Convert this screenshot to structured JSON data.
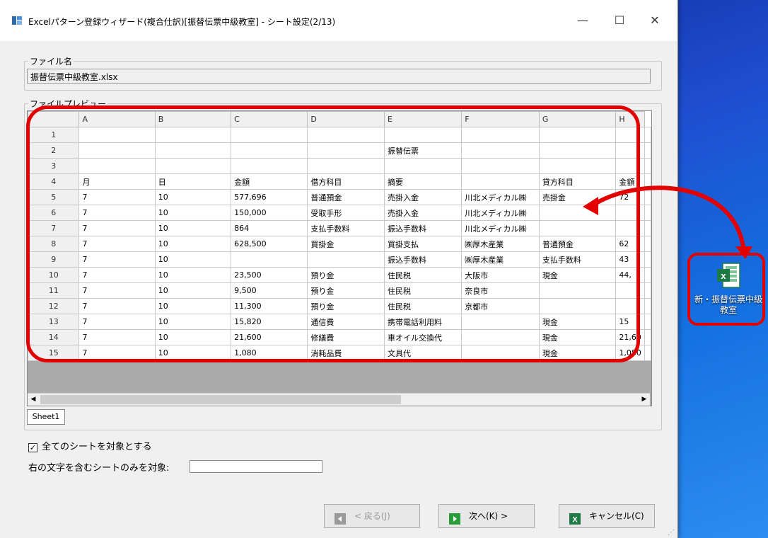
{
  "window": {
    "title": "Excelパターン登録ウィザード(複合仕訳)[振替伝票中級教室] - シート設定(2/13)",
    "minimize": "—",
    "maximize": "☐",
    "close": "✕"
  },
  "file_section": {
    "label": "ファイル名",
    "value": "振替伝票中級教室.xlsx"
  },
  "preview_section": {
    "label": "ファイルプレビュー",
    "columns": [
      "A",
      "B",
      "C",
      "D",
      "E",
      "F",
      "G",
      "H"
    ],
    "rows": [
      {
        "n": "1",
        "cells": [
          "",
          "",
          "",
          "",
          "",
          "",
          "",
          ""
        ]
      },
      {
        "n": "2",
        "cells": [
          "",
          "",
          "",
          "",
          "振替伝票",
          "",
          "",
          ""
        ]
      },
      {
        "n": "3",
        "cells": [
          "",
          "",
          "",
          "",
          "",
          "",
          "",
          ""
        ]
      },
      {
        "n": "4",
        "cells": [
          "月",
          "日",
          "金額",
          "借方科目",
          "摘要",
          "",
          "貸方科目",
          "金額"
        ]
      },
      {
        "n": "5",
        "cells": [
          "7",
          "10",
          "577,696",
          "普通預金",
          "売掛入金",
          "川北メディカル㈱",
          "売掛金",
          "72"
        ]
      },
      {
        "n": "6",
        "cells": [
          "7",
          "10",
          "150,000",
          "受取手形",
          "売掛入金",
          "川北メディカル㈱",
          "",
          ""
        ]
      },
      {
        "n": "7",
        "cells": [
          "7",
          "10",
          "864",
          "支払手数料",
          "振込手数料",
          "川北メディカル㈱",
          "",
          ""
        ]
      },
      {
        "n": "8",
        "cells": [
          "7",
          "10",
          "628,500",
          "買掛金",
          "買掛支払",
          "㈱厚木産業",
          "普通預金",
          "62"
        ]
      },
      {
        "n": "9",
        "cells": [
          "7",
          "10",
          "",
          "",
          "振込手数料",
          "㈱厚木産業",
          "支払手数料",
          "43"
        ]
      },
      {
        "n": "10",
        "cells": [
          "7",
          "10",
          "23,500",
          "預り金",
          "住民税",
          "大阪市",
          "現金",
          "44,"
        ]
      },
      {
        "n": "11",
        "cells": [
          "7",
          "10",
          "9,500",
          "預り金",
          "住民税",
          "奈良市",
          "",
          ""
        ]
      },
      {
        "n": "12",
        "cells": [
          "7",
          "10",
          "11,300",
          "預り金",
          "住民税",
          "京都市",
          "",
          ""
        ]
      },
      {
        "n": "13",
        "cells": [
          "7",
          "10",
          "15,820",
          "通信費",
          "携帯電話利用料",
          "",
          "現金",
          "15"
        ]
      },
      {
        "n": "14",
        "cells": [
          "7",
          "10",
          "21,600",
          "修繕費",
          "車オイル交換代",
          "",
          "現金",
          "21,60"
        ]
      },
      {
        "n": "15",
        "cells": [
          "7",
          "10",
          "1,080",
          "消耗品費",
          "文具代",
          "",
          "現金",
          "1,080"
        ]
      }
    ],
    "sheet_tab": "Sheet1"
  },
  "options": {
    "all_sheets_label": "全てのシートを対象とする",
    "all_sheets_checked": true,
    "filter_label": "右の文字を含むシートのみを対象:",
    "filter_value": ""
  },
  "buttons": {
    "back": "< 戻る(J)",
    "next": "次へ(K) >",
    "cancel": "キャンセル(C)"
  },
  "desktop": {
    "icon_label": "新・振替伝票中級教室"
  },
  "colors": {
    "highlight": "#e30000",
    "excel_green": "#1d7a44"
  }
}
